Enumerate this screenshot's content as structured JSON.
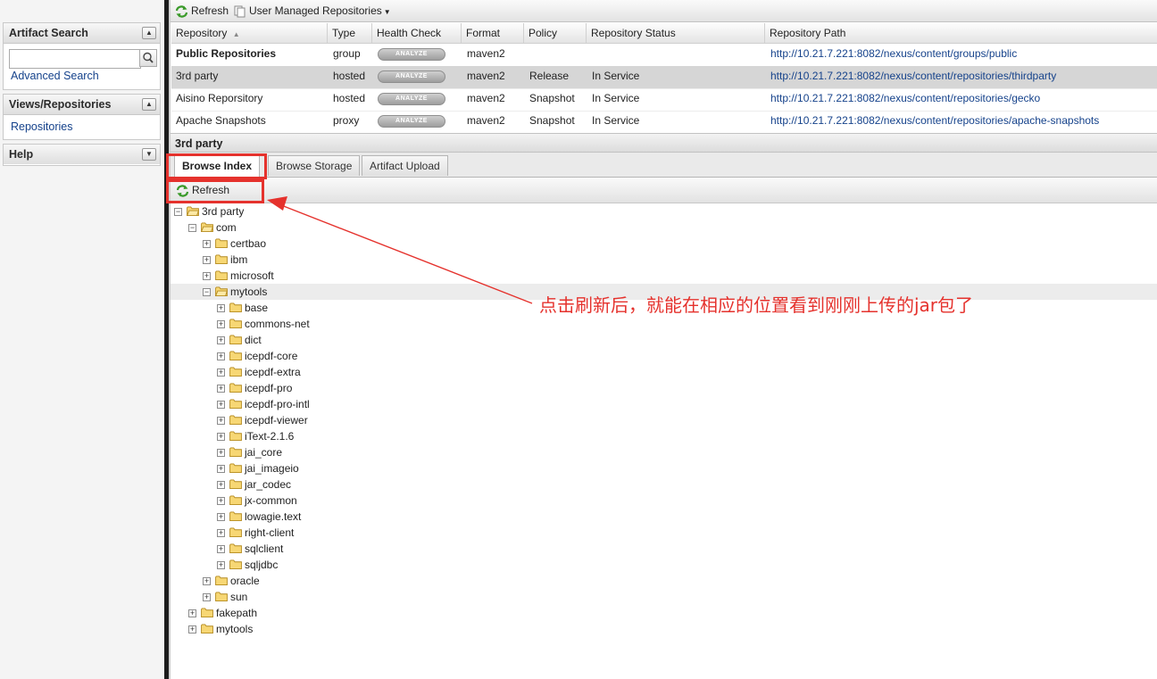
{
  "sidebar": {
    "artifact_search": {
      "title": "Artifact Search",
      "search_value": "",
      "advanced_link": "Advanced Search"
    },
    "views": {
      "title": "Views/Repositories",
      "link": "Repositories"
    },
    "help": {
      "title": "Help"
    }
  },
  "toolbar": {
    "refresh_label": "Refresh",
    "repos_menu_label": "User Managed Repositories"
  },
  "grid": {
    "columns": [
      "Repository",
      "Type",
      "Health Check",
      "Format",
      "Policy",
      "Repository Status",
      "Repository Path"
    ],
    "analyze_label": "ANALYZE",
    "rows": [
      {
        "name": "Public Repositories",
        "type": "group",
        "format": "maven2",
        "policy": "",
        "status": "",
        "path": "http://10.21.7.221:8082/nexus/content/groups/public"
      },
      {
        "name": "3rd party",
        "type": "hosted",
        "format": "maven2",
        "policy": "Release",
        "status": "In Service",
        "path": "http://10.21.7.221:8082/nexus/content/repositories/thirdparty"
      },
      {
        "name": "Aisino Reporsitory",
        "type": "hosted",
        "format": "maven2",
        "policy": "Snapshot",
        "status": "In Service",
        "path": "http://10.21.7.221:8082/nexus/content/repositories/gecko"
      },
      {
        "name": "Apache Snapshots",
        "type": "proxy",
        "format": "maven2",
        "policy": "Snapshot",
        "status": "In Service",
        "path": "http://10.21.7.221:8082/nexus/content/repositories/apache-snapshots"
      }
    ],
    "selected_row": 1
  },
  "detail": {
    "title": "3rd party",
    "tabs": [
      "Browse Index",
      "Browse Storage",
      "Artifact Upload"
    ],
    "active_tab": 0,
    "refresh_label": "Refresh"
  },
  "tree": [
    {
      "label": "3rd party",
      "level": 0,
      "expanded": true
    },
    {
      "label": "com",
      "level": 1,
      "expanded": true
    },
    {
      "label": "certbao",
      "level": 2,
      "expanded": false
    },
    {
      "label": "ibm",
      "level": 2,
      "expanded": false
    },
    {
      "label": "microsoft",
      "level": 2,
      "expanded": false
    },
    {
      "label": "mytools",
      "level": 2,
      "expanded": true,
      "selected": true
    },
    {
      "label": "base",
      "level": 3,
      "expanded": false
    },
    {
      "label": "commons-net",
      "level": 3,
      "expanded": false
    },
    {
      "label": "dict",
      "level": 3,
      "expanded": false
    },
    {
      "label": "icepdf-core",
      "level": 3,
      "expanded": false
    },
    {
      "label": "icepdf-extra",
      "level": 3,
      "expanded": false
    },
    {
      "label": "icepdf-pro",
      "level": 3,
      "expanded": false
    },
    {
      "label": "icepdf-pro-intl",
      "level": 3,
      "expanded": false
    },
    {
      "label": "icepdf-viewer",
      "level": 3,
      "expanded": false
    },
    {
      "label": "iText-2.1.6",
      "level": 3,
      "expanded": false
    },
    {
      "label": "jai_core",
      "level": 3,
      "expanded": false
    },
    {
      "label": "jai_imageio",
      "level": 3,
      "expanded": false
    },
    {
      "label": "jar_codec",
      "level": 3,
      "expanded": false
    },
    {
      "label": "jx-common",
      "level": 3,
      "expanded": false
    },
    {
      "label": "lowagie.text",
      "level": 3,
      "expanded": false
    },
    {
      "label": "right-client",
      "level": 3,
      "expanded": false
    },
    {
      "label": "sqlclient",
      "level": 3,
      "expanded": false
    },
    {
      "label": "sqljdbc",
      "level": 3,
      "expanded": false
    },
    {
      "label": "oracle",
      "level": 2,
      "expanded": false
    },
    {
      "label": "sun",
      "level": 2,
      "expanded": false
    },
    {
      "label": "fakepath",
      "level": 1,
      "expanded": false
    },
    {
      "label": "mytools",
      "level": 1,
      "expanded": false
    }
  ],
  "annotation": {
    "text": "点击刷新后，就能在相应的位置看到刚刚上传的jar包了",
    "color": "#e5322d"
  },
  "colors": {
    "link": "#15428b",
    "highlight": "#e5322d",
    "selected_row": "#d6d6d6"
  }
}
